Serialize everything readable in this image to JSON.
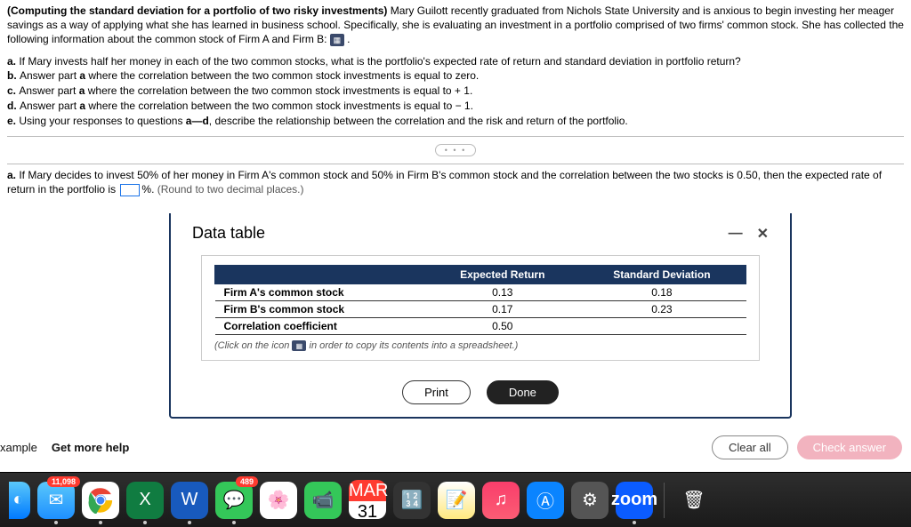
{
  "intro": {
    "bold_lead": "(Computing the standard deviation for a portfolio of two risky investments)",
    "text1": " Mary Guilott recently graduated from Nichols State University and is anxious to begin investing her meager savings as a way of applying what she has learned in business school. Specifically, she is evaluating an investment in a portfolio comprised of two firms' common stock. She has collected the following information about the common stock of Firm A and Firm B: "
  },
  "questions": {
    "a": "If Mary invests half her money in each of the two common stocks, what is the portfolio's expected rate of return and standard deviation in portfolio return?",
    "b_pre": "Answer part ",
    "b_bold": "a",
    "b_post": " where the correlation between the two common stock investments is equal to zero.",
    "c_pre": "Answer part ",
    "c_bold": "a",
    "c_post": " where the correlation between the two common stock investments is equal to + 1.",
    "d_pre": "Answer part ",
    "d_bold": "a",
    "d_post": " where the correlation between the two common stock investments is equal to − 1.",
    "e_pre": "Using your responses to questions ",
    "e_bold": "a—d",
    "e_post": ", describe the relationship between the correlation and the risk and return of the portfolio."
  },
  "part_a": {
    "lead": "a.",
    "text_before_box": " If Mary decides to invest 50% of her money in Firm A's common stock and 50% in Firm B's common stock and the correlation between the two stocks is 0.50, then the expected rate of return in the portfolio is ",
    "unit": "%. ",
    "hint": "(Round to two decimal places.)"
  },
  "modal": {
    "title": "Data table",
    "headers": {
      "c1": "Expected Return",
      "c2": "Standard Deviation"
    },
    "rows": {
      "r1": {
        "label": "Firm A's common stock",
        "er": "0.13",
        "sd": "0.18"
      },
      "r2": {
        "label": "Firm B's common stock",
        "er": "0.17",
        "sd": "0.23"
      },
      "r3": {
        "label": "Correlation coefficient",
        "er": "0.50",
        "sd": ""
      }
    },
    "copy_hint_pre": "(Click on the icon ",
    "copy_hint_post": " in order to copy its contents into a spreadsheet.)",
    "print": "Print",
    "done": "Done"
  },
  "bottom": {
    "example": "xample",
    "help": "Get more help",
    "clear": "Clear all",
    "check": "Check answer"
  },
  "dock": {
    "mail_badge": "11,098",
    "msg_badge": "489",
    "cal_month": "MAR",
    "cal_day": "31",
    "zoom": "zoom"
  },
  "chart_data": {
    "type": "table",
    "title": "Data table",
    "columns": [
      "",
      "Expected Return",
      "Standard Deviation"
    ],
    "rows": [
      [
        "Firm A's common stock",
        0.13,
        0.18
      ],
      [
        "Firm B's common stock",
        0.17,
        0.23
      ],
      [
        "Correlation coefficient",
        0.5,
        null
      ]
    ]
  }
}
